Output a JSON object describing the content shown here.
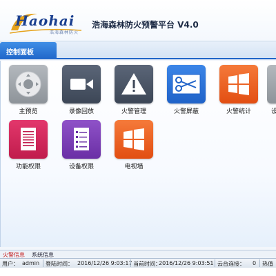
{
  "header": {
    "logo_text": "Haohai",
    "logo_sub": "浩海森林防火",
    "title": "浩海森林防火预警平台 V4.0"
  },
  "tabs": {
    "active_label": "控制面板"
  },
  "tiles": [
    {
      "label": "主预览",
      "icon": "remote-control-icon",
      "color": "#9aa0a6"
    },
    {
      "label": "录像回放",
      "icon": "video-camera-icon",
      "color": "#4a5566"
    },
    {
      "label": "火警管理",
      "icon": "warning-triangle-icon",
      "color": "#4a5566"
    },
    {
      "label": "火警屏蔽",
      "icon": "scissors-icon",
      "color": "#2a6fd6"
    },
    {
      "label": "火警统计",
      "icon": "windows-logo-icon",
      "color": "#ef5a1e"
    },
    {
      "label": "设",
      "icon": "settings-icon",
      "color": "#9aa0a6"
    },
    {
      "label": "功能权限",
      "icon": "document-list-icon",
      "color": "#d0245a"
    },
    {
      "label": "设备权限",
      "icon": "checklist-icon",
      "color": "#7b3fb5"
    },
    {
      "label": "电视墙",
      "icon": "windows-logo-icon",
      "color": "#ef5a1e"
    }
  ],
  "bottom_tabs": {
    "fire_info": "火警信息",
    "system_info": "系统信息"
  },
  "status": {
    "user_label": "用户：",
    "user_value": "admin",
    "login_label": "登陆时间：",
    "login_value": "2016/12/26 9:03:17",
    "current_label": "当前时间：",
    "current_value": "2016/12/26 9:03:51",
    "ptz_label": "云台连接：",
    "ptz_value": "0",
    "thermal_label": "热值"
  }
}
